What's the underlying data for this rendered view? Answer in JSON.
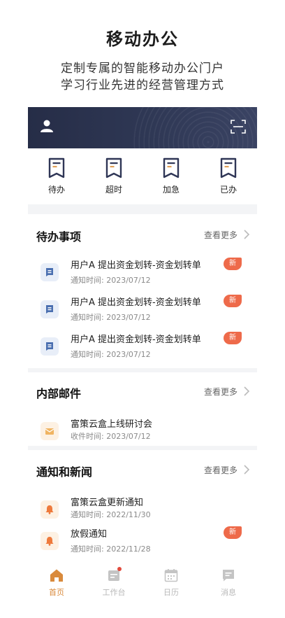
{
  "hero": {
    "title": "移动办公",
    "line1": "定制专属的智能移动办公门户",
    "line2": "学习行业先进的经营管理方式"
  },
  "banner": {
    "user_icon": "user-icon",
    "scan_icon": "scan-icon"
  },
  "quick_actions": [
    {
      "label": "待办",
      "icon": "document-icon"
    },
    {
      "label": "超时",
      "icon": "document-icon"
    },
    {
      "label": "加急",
      "icon": "document-icon"
    },
    {
      "label": "已办",
      "icon": "document-icon"
    }
  ],
  "todo": {
    "title": "待办事项",
    "more": "查看更多",
    "items": [
      {
        "title": "用户A 提出资金划转-资金划转单",
        "meta_label": "通知时间:",
        "date": "2023/07/12",
        "badge": "新"
      },
      {
        "title": "用户A 提出资金划转-资金划转单",
        "meta_label": "通知时间:",
        "date": "2023/07/12",
        "badge": "新"
      },
      {
        "title": "用户A 提出资金划转-资金划转单",
        "meta_label": "通知时间:",
        "date": "2023/07/12",
        "badge": "新"
      }
    ]
  },
  "mail": {
    "title": "内部邮件",
    "more": "查看更多",
    "items": [
      {
        "title": "富策云盒上线研讨会",
        "meta_label": "收件时间:",
        "date": "2023/07/12"
      }
    ]
  },
  "news": {
    "title": "通知和新闻",
    "more": "查看更多",
    "items": [
      {
        "title": "富策云盒更新通知",
        "meta_label": "通知时间:",
        "date": "2022/11/30"
      },
      {
        "title": "放假通知",
        "meta_label": "通知时间:",
        "date": "2022/11/28",
        "badge": "新"
      }
    ]
  },
  "tabbar": [
    {
      "label": "首页",
      "icon": "home-icon",
      "active": true
    },
    {
      "label": "工作台",
      "icon": "workbench-icon",
      "active": false
    },
    {
      "label": "日历",
      "icon": "calendar-icon",
      "active": false
    },
    {
      "label": "消息",
      "icon": "message-icon",
      "active": false
    }
  ],
  "colors": {
    "accent": "#d98a3c",
    "badge": "#ee6a4a",
    "banner": "#2b3350",
    "nav_dark": "#2f3656"
  }
}
